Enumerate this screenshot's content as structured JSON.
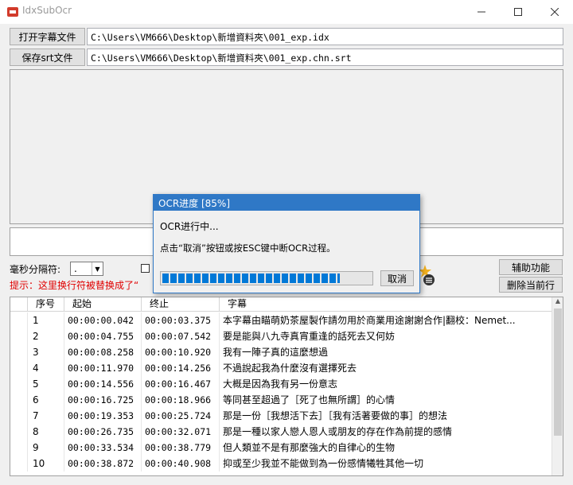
{
  "window": {
    "title": "IdxSubOcr"
  },
  "toolbar": {
    "open_button": "打开字幕文件",
    "open_path": "C:\\Users\\VM666\\Desktop\\新增資料夾\\001_exp.idx",
    "save_button": "保存srt文件",
    "save_path": "C:\\Users\\VM666\\Desktop\\新增資料夾\\001_exp.chn.srt"
  },
  "options": {
    "ms_separator_label": "毫秒分隔符:",
    "ms_separator_value": ".",
    "hint": "提示：这里换行符被替换成了“",
    "assist_button": "辅助功能",
    "delete_row_button": "删除当前行"
  },
  "table": {
    "columns": [
      "序号",
      "起始",
      "终止",
      "字幕"
    ],
    "rows": [
      [
        "1",
        "00:00:00.042",
        "00:00:03.375",
        "本字幕由瞄萌奶茶屋製作請勿用於商業用途謝謝合作|翻校：Nemet..."
      ],
      [
        "2",
        "00:00:04.755",
        "00:00:07.542",
        "要是能與八九寺真宵重逢的話死去又何妨"
      ],
      [
        "3",
        "00:00:08.258",
        "00:00:10.920",
        "我有一陣子真的這麼想過"
      ],
      [
        "4",
        "00:00:11.970",
        "00:00:14.256",
        "不過說起我為什麼沒有選擇死去"
      ],
      [
        "5",
        "00:00:14.556",
        "00:00:16.467",
        "大概是因為我有另一份意志"
      ],
      [
        "6",
        "00:00:16.725",
        "00:00:18.966",
        "等同甚至超過了［死了也無所謂］的心情"
      ],
      [
        "7",
        "00:00:19.353",
        "00:00:25.724",
        "那是一份［我想活下去］［我有活著要做的事］的想法"
      ],
      [
        "8",
        "00:00:26.735",
        "00:00:32.071",
        "那是一種以家人戀人恩人或朋友的存在作為前提的感情"
      ],
      [
        "9",
        "00:00:33.534",
        "00:00:38.779",
        "但人類並不是有那麼強大的自律心的生物"
      ],
      [
        "10",
        "00:00:38.872",
        "00:00:40.908",
        "抑或至少我並不能做到為一份感情犧牲其他一切"
      ]
    ]
  },
  "dialog": {
    "title": "OCR进度 [85%]",
    "status": "OCR进行中...",
    "instruction": "点击“取消”按钮或按ESC键中断OCR过程。",
    "cancel_button": "取消",
    "progress": 0.85
  },
  "colors": {
    "accent": "#2f78c6",
    "progress": "#0078d7",
    "hint": "#e00000"
  }
}
